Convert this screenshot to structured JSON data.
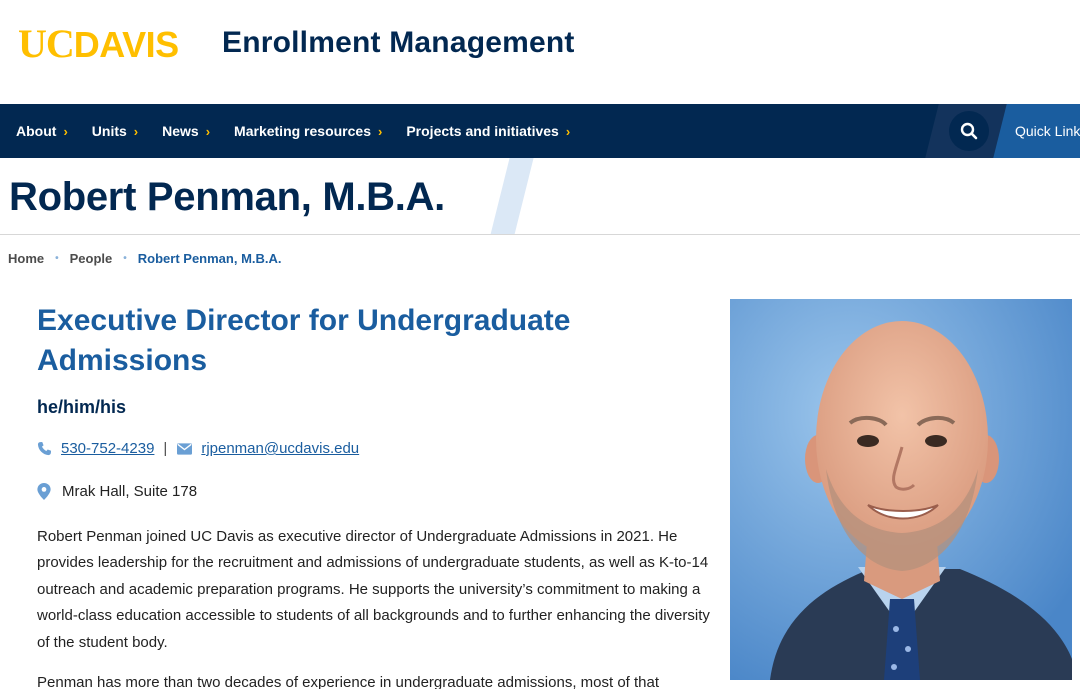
{
  "header": {
    "logo": {
      "uc": "UC",
      "davis": "DAVIS"
    },
    "site_name": "Enrollment Management"
  },
  "nav": {
    "items": [
      {
        "label": "About"
      },
      {
        "label": "Units"
      },
      {
        "label": "News"
      },
      {
        "label": "Marketing resources"
      },
      {
        "label": "Projects and initiatives"
      }
    ],
    "search_icon": "search-icon",
    "quick_links": "Quick Links"
  },
  "page": {
    "title": "Robert Penman, M.B.A."
  },
  "breadcrumb": {
    "items": [
      "Home",
      "People"
    ],
    "current": "Robert Penman, M.B.A."
  },
  "profile": {
    "job_title": "Executive Director for Undergraduate Admissions",
    "pronouns": "he/him/his",
    "phone": "530-752-4239",
    "email": "rjpenman@ucdavis.edu",
    "location": "Mrak Hall, Suite 178",
    "bio": [
      "Robert Penman joined UC Davis as executive director of Undergraduate Admissions in 2021. He provides leadership for the recruitment and admissions of undergraduate students, as well as K-to-14 outreach and academic preparation programs. He supports the university’s commitment to making a world-class education accessible to students of all backgrounds and to further enhancing the diversity of the student body.",
      "Penman has more than two decades of experience in undergraduate admissions, most of that"
    ]
  },
  "colors": {
    "navy": "#022851",
    "gold": "#FFBF00",
    "blue": "#1a5d9f",
    "light_blue": "#dbe8f6"
  }
}
